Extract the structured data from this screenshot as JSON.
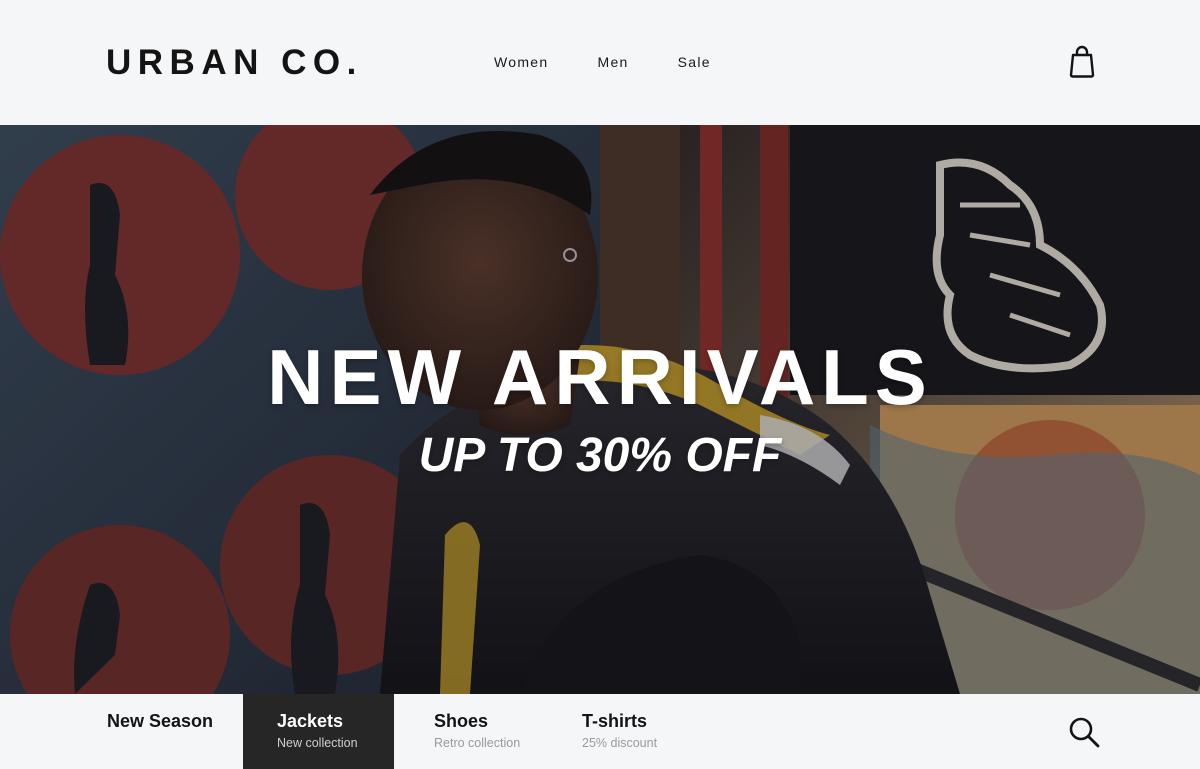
{
  "header": {
    "logo": "URBAN CO.",
    "nav": [
      "Women",
      "Men",
      "Sale"
    ],
    "cart_icon": "shopping-bag-icon"
  },
  "hero": {
    "title": "NEW ARRIVALS",
    "subtitle": "UP TO 30% OFF"
  },
  "categories": [
    {
      "title": "New Season",
      "subtitle": "",
      "active": false
    },
    {
      "title": "Jackets",
      "subtitle": "New collection",
      "active": true
    },
    {
      "title": "Shoes",
      "subtitle": "Retro collection",
      "active": false
    },
    {
      "title": "T-shirts",
      "subtitle": "25% discount",
      "active": false
    }
  ],
  "search_icon": "search-icon",
  "colors": {
    "background": "#f5f6f8",
    "text": "#141414",
    "active_tab": "#262626",
    "hero_text": "#ffffff",
    "muted_text": "#9a9a9a"
  }
}
